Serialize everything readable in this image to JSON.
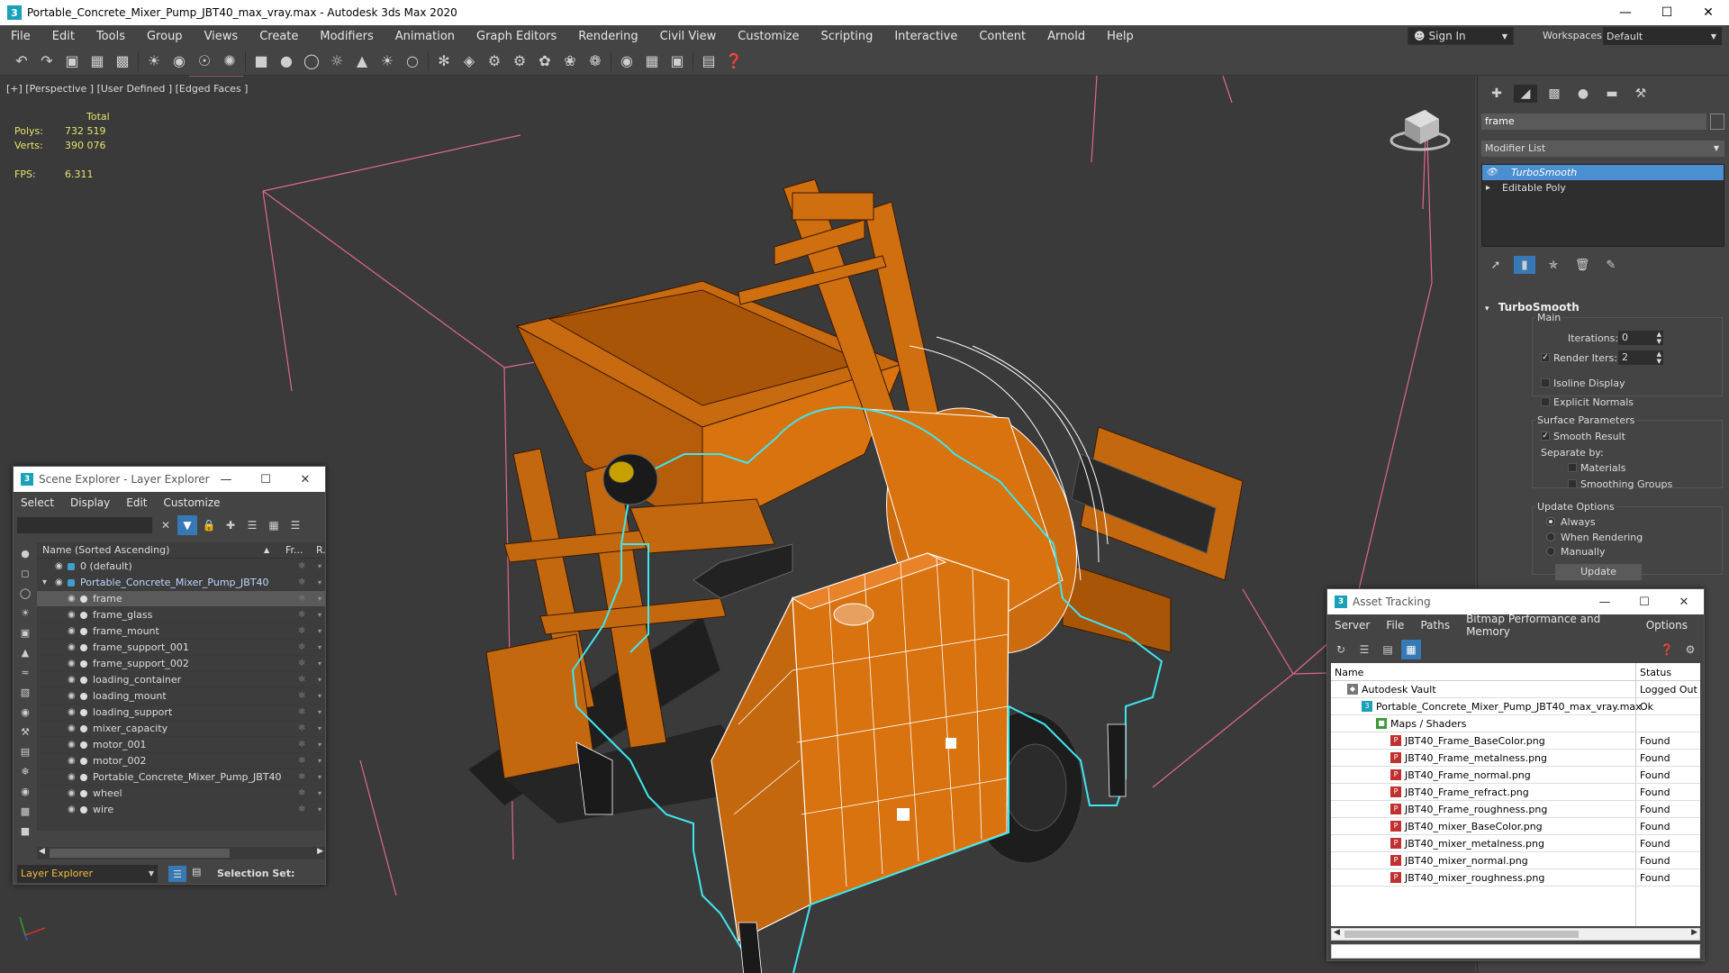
{
  "window": {
    "title": "Portable_Concrete_Mixer_Pump_JBT40_max_vray.max - Autodesk 3ds Max 2020"
  },
  "menubar": {
    "items": [
      "File",
      "Edit",
      "Tools",
      "Group",
      "Views",
      "Create",
      "Modifiers",
      "Animation",
      "Graph Editors",
      "Rendering",
      "Civil View",
      "Customize",
      "Scripting",
      "Interactive",
      "Content",
      "Arnold",
      "Help"
    ],
    "sign_in": "Sign In",
    "workspaces_label": "Workspaces:",
    "workspace_value": "Default"
  },
  "viewport": {
    "label": "[+] [Perspective ] [User Defined ] [Edged Faces ]",
    "stats_header": "Total",
    "polys_label": "Polys:",
    "polys_value": "732 519",
    "verts_label": "Verts:",
    "verts_value": "390 076",
    "fps_label": "FPS:",
    "fps_value": "6.311",
    "colors": {
      "background": "#3a3a3a",
      "mesh_orange": "#d8730f",
      "selection_outline": "#3fe6ee",
      "wire_white": "#ffffff",
      "bbox_pink": "#e0688c"
    }
  },
  "command_panel": {
    "object_name": "frame",
    "modifier_list": "Modifier List",
    "stack": [
      "TurboSmooth",
      "Editable Poly"
    ],
    "rollout_title": "TurboSmooth",
    "main_label": "Main",
    "iterations_label": "Iterations:",
    "iterations_value": "0",
    "render_iters_label": "Render Iters:",
    "render_iters_value": "2",
    "isoline_display": "Isoline Display",
    "explicit_normals": "Explicit Normals",
    "surface_params": "Surface Parameters",
    "smooth_result": "Smooth Result",
    "separate_by": "Separate by:",
    "materials": "Materials",
    "smoothing_groups": "Smoothing Groups",
    "update_options": "Update Options",
    "always": "Always",
    "when_rendering": "When Rendering",
    "manually": "Manually",
    "update_button": "Update"
  },
  "scene_explorer": {
    "title": "Scene Explorer - Layer Explorer",
    "menu": [
      "Select",
      "Display",
      "Edit",
      "Customize"
    ],
    "col_name": "Name (Sorted Ascending)",
    "col_frozen": "Fr...",
    "col_render": "R.",
    "rows": [
      {
        "name": "0 (default)",
        "level": 0,
        "selected": false
      },
      {
        "name": "Portable_Concrete_Mixer_Pump_JBT40",
        "level": 0,
        "selected": false
      },
      {
        "name": "frame",
        "level": 1,
        "selected": true
      },
      {
        "name": "frame_glass",
        "level": 1,
        "selected": false
      },
      {
        "name": "frame_mount",
        "level": 1,
        "selected": false
      },
      {
        "name": "frame_support_001",
        "level": 1,
        "selected": false
      },
      {
        "name": "frame_support_002",
        "level": 1,
        "selected": false
      },
      {
        "name": "loading_container",
        "level": 1,
        "selected": false
      },
      {
        "name": "loading_mount",
        "level": 1,
        "selected": false
      },
      {
        "name": "loading_support",
        "level": 1,
        "selected": false
      },
      {
        "name": "mixer_capacity",
        "level": 1,
        "selected": false
      },
      {
        "name": "motor_001",
        "level": 1,
        "selected": false
      },
      {
        "name": "motor_002",
        "level": 1,
        "selected": false
      },
      {
        "name": "Portable_Concrete_Mixer_Pump_JBT40",
        "level": 1,
        "selected": false
      },
      {
        "name": "wheel",
        "level": 1,
        "selected": false
      },
      {
        "name": "wire",
        "level": 1,
        "selected": false
      }
    ],
    "footer_layer": "Layer Explorer",
    "footer_selset": "Selection Set:"
  },
  "asset_tracking": {
    "title": "Asset Tracking",
    "menu": [
      "Server",
      "File",
      "Paths",
      "Bitmap Performance and Memory",
      "Options"
    ],
    "col_name": "Name",
    "col_status": "Status",
    "rows": [
      {
        "name": "Autodesk Vault",
        "status": "Logged Out",
        "level": 0,
        "icon": "vault-icon"
      },
      {
        "name": "Portable_Concrete_Mixer_Pump_JBT40_max_vray.max",
        "status": "Ok",
        "level": 1,
        "icon": "max-file-icon"
      },
      {
        "name": "Maps / Shaders",
        "status": "",
        "level": 2,
        "icon": "maps-icon"
      },
      {
        "name": "JBT40_Frame_BaseColor.png",
        "status": "Found",
        "level": 3,
        "icon": "png-icon"
      },
      {
        "name": "JBT40_Frame_metalness.png",
        "status": "Found",
        "level": 3,
        "icon": "png-icon"
      },
      {
        "name": "JBT40_Frame_normal.png",
        "status": "Found",
        "level": 3,
        "icon": "png-icon"
      },
      {
        "name": "JBT40_Frame_refract.png",
        "status": "Found",
        "level": 3,
        "icon": "png-icon"
      },
      {
        "name": "JBT40_Frame_roughness.png",
        "status": "Found",
        "level": 3,
        "icon": "png-icon"
      },
      {
        "name": "JBT40_mixer_BaseColor.png",
        "status": "Found",
        "level": 3,
        "icon": "png-icon"
      },
      {
        "name": "JBT40_mixer_metalness.png",
        "status": "Found",
        "level": 3,
        "icon": "png-icon"
      },
      {
        "name": "JBT40_mixer_normal.png",
        "status": "Found",
        "level": 3,
        "icon": "png-icon"
      },
      {
        "name": "JBT40_mixer_roughness.png",
        "status": "Found",
        "level": 3,
        "icon": "png-icon"
      }
    ]
  }
}
